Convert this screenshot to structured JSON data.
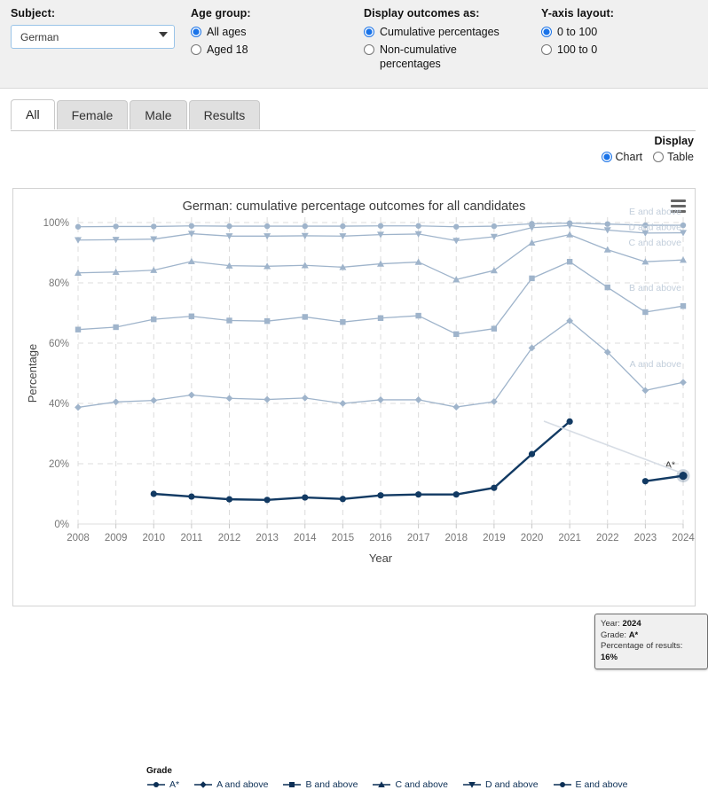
{
  "controls": {
    "subject": {
      "label": "Subject:",
      "value": "German",
      "options": [
        "German"
      ]
    },
    "age_group": {
      "label": "Age group:",
      "options": [
        "All ages",
        "Aged 18"
      ],
      "selected": "All ages"
    },
    "display_outcomes": {
      "label": "Display outcomes as:",
      "options": [
        "Cumulative percentages",
        "Non-cumulative percentages"
      ],
      "selected": "Cumulative percentages"
    },
    "yaxis_layout": {
      "label": "Y-axis layout:",
      "options": [
        "0 to 100",
        "100 to 0"
      ],
      "selected": "0 to 100"
    }
  },
  "tabs": [
    {
      "label": "All",
      "active": true
    },
    {
      "label": "Female",
      "active": false
    },
    {
      "label": "Male",
      "active": false
    },
    {
      "label": "Results",
      "active": false
    }
  ],
  "display": {
    "title": "Display",
    "options": [
      "Chart",
      "Table"
    ],
    "selected": "Chart"
  },
  "chart_menu_icon": "hamburger-menu-icon",
  "tooltip": {
    "year_label": "Year:",
    "year_value": "2024",
    "grade_label": "Grade:",
    "grade_value": "A*",
    "percentage_label": "Percentage of results:",
    "percentage_value": "16%"
  },
  "legend": {
    "title": "Grade",
    "items": [
      "A*",
      "A and above",
      "B and above",
      "C and above",
      "D and above",
      "E and above"
    ]
  },
  "series_end_labels": [
    "E and above",
    "D and above",
    "C and above",
    "B and above",
    "A and above",
    "A*"
  ],
  "colors": {
    "accent": "#1a73e8",
    "series_dark": "#123a63",
    "series_light": "#9fb4cb",
    "grid": "#dcdcdc",
    "panel": "#f0f0f0"
  },
  "chart_data": {
    "type": "line",
    "title": "German: cumulative percentage outcomes for all candidates",
    "xlabel": "Year",
    "ylabel": "Percentage",
    "ylim": [
      0,
      100
    ],
    "ytick_labels": [
      "0%",
      "20%",
      "40%",
      "60%",
      "80%",
      "100%"
    ],
    "yticks": [
      0,
      20,
      40,
      60,
      80,
      100
    ],
    "grid": true,
    "legend_position": "bottom",
    "categories": [
      2008,
      2009,
      2010,
      2011,
      2012,
      2013,
      2014,
      2015,
      2016,
      2017,
      2018,
      2019,
      2020,
      2021,
      2022,
      2023,
      2024
    ],
    "series": [
      {
        "name": "A*",
        "marker": "circle",
        "color": "#123a63",
        "values": [
          null,
          null,
          10.0,
          9.1,
          8.2,
          8.0,
          8.8,
          8.3,
          9.5,
          9.8,
          9.8,
          12.0,
          23.2,
          34.0,
          null,
          14.2,
          16.0
        ]
      },
      {
        "name": "A and above",
        "marker": "diamond",
        "color": "#9fb4cb",
        "values": [
          38.7,
          40.5,
          41.0,
          42.8,
          41.7,
          41.3,
          41.8,
          40.0,
          41.2,
          41.2,
          38.8,
          40.6,
          58.4,
          67.4,
          57.0,
          44.3,
          47.0
        ]
      },
      {
        "name": "B and above",
        "marker": "square",
        "color": "#9fb4cb",
        "values": [
          64.5,
          65.3,
          67.9,
          68.9,
          67.5,
          67.3,
          68.7,
          67.0,
          68.3,
          69.1,
          63.0,
          64.8,
          81.5,
          87.0,
          78.5,
          70.3,
          72.3
        ]
      },
      {
        "name": "C and above",
        "marker": "triangle-up",
        "color": "#9fb4cb",
        "values": [
          83.3,
          83.6,
          84.2,
          87.1,
          85.7,
          85.5,
          85.8,
          85.2,
          86.3,
          86.9,
          81.1,
          84.1,
          93.3,
          96.0,
          91.0,
          87.0,
          87.6
        ]
      },
      {
        "name": "D and above",
        "marker": "triangle-down",
        "color": "#9fb4cb",
        "values": [
          94.2,
          94.3,
          94.5,
          96.3,
          95.5,
          95.5,
          95.6,
          95.5,
          96.0,
          96.2,
          94.0,
          95.3,
          98.3,
          99.0,
          97.5,
          96.5,
          96.6
        ]
      },
      {
        "name": "E and above",
        "marker": "circle",
        "color": "#9fb4cb",
        "values": [
          98.6,
          98.7,
          98.7,
          98.9,
          98.8,
          98.8,
          98.8,
          98.8,
          98.9,
          98.9,
          98.6,
          98.8,
          99.6,
          99.8,
          99.5,
          99.1,
          99.1
        ]
      }
    ]
  }
}
